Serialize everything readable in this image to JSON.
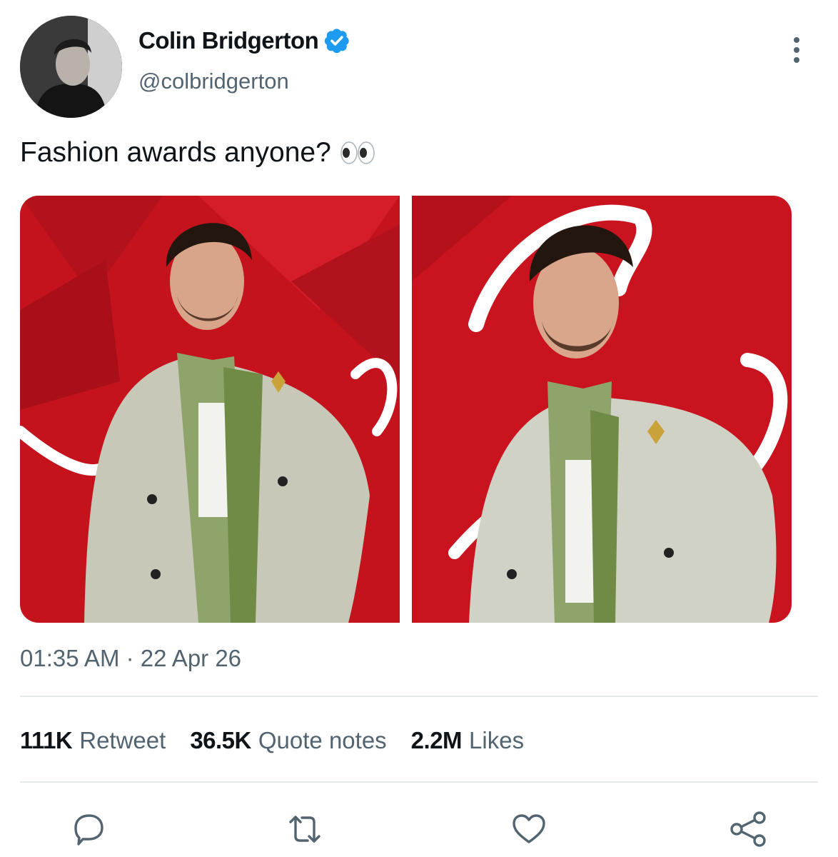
{
  "author": {
    "name": "Colin Bridgerton",
    "handle": "@colbridgerton",
    "verified": true,
    "verified_color": "#1d9bf0"
  },
  "tweet": {
    "text": "Fashion awards anyone?",
    "emoji_icon": "eyes-emoji-icon",
    "timestamp": "01:35 AM · 22 Apr 26"
  },
  "media": [
    {
      "description_icon": "photo-man-grey-suit-full"
    },
    {
      "description_icon": "photo-man-grey-suit-closeup"
    }
  ],
  "stats": [
    {
      "count": "111K",
      "label": "Retweet"
    },
    {
      "count": "36.5K",
      "label": "Quote notes"
    },
    {
      "count": "2.2M",
      "label": "Likes"
    }
  ],
  "actions": [
    {
      "icon": "reply-icon"
    },
    {
      "icon": "retweet-icon"
    },
    {
      "icon": "like-icon"
    },
    {
      "icon": "share-icon"
    }
  ],
  "colors": {
    "text_primary": "#0f1419",
    "text_secondary": "#536471",
    "divider": "#e6e9ea",
    "backdrop_red": "#c5131e"
  }
}
